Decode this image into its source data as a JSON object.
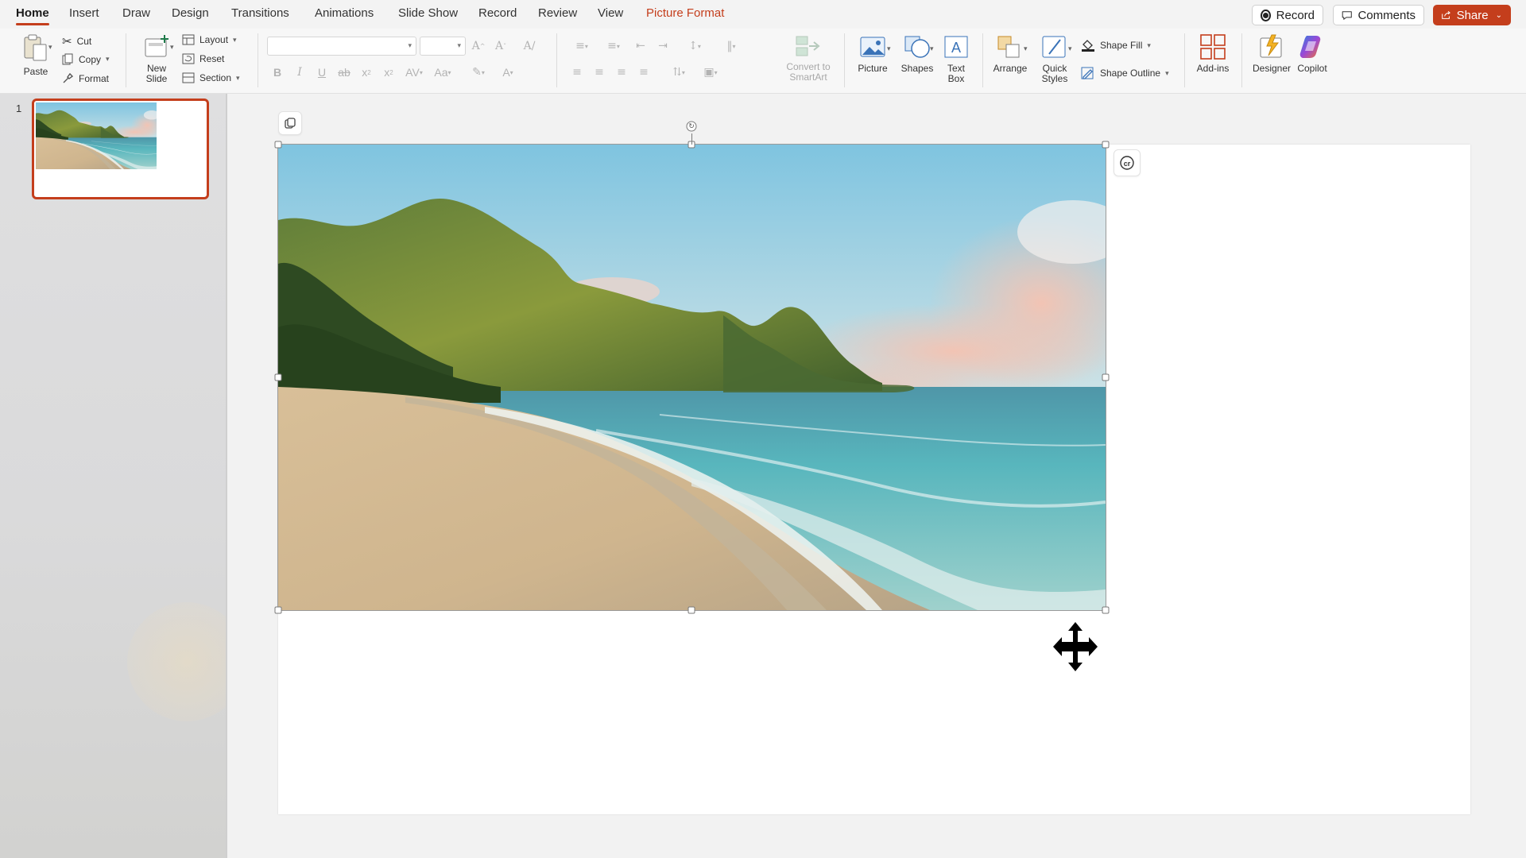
{
  "tabs": [
    {
      "label": "Home",
      "active": true
    },
    {
      "label": "Insert"
    },
    {
      "label": "Draw"
    },
    {
      "label": "Design"
    },
    {
      "label": "Transitions"
    },
    {
      "label": "Animations"
    },
    {
      "label": "Slide Show"
    },
    {
      "label": "Record"
    },
    {
      "label": "Review"
    },
    {
      "label": "View"
    },
    {
      "label": "Picture Format",
      "contextual": true
    }
  ],
  "top_actions": {
    "record_label": "Record",
    "comments_label": "Comments",
    "share_label": "Share"
  },
  "ribbon": {
    "clipboard": {
      "paste": "Paste",
      "cut": "Cut",
      "copy": "Copy",
      "format": "Format"
    },
    "slides": {
      "new_slide_line1": "New",
      "new_slide_line2": "Slide",
      "layout": "Layout",
      "reset": "Reset",
      "section": "Section"
    },
    "font": {
      "font_name": "",
      "font_size": ""
    },
    "paragraph": {
      "convert_line1": "Convert to",
      "convert_line2": "SmartArt"
    },
    "insert": {
      "picture": "Picture",
      "shapes": "Shapes",
      "textbox_line1": "Text",
      "textbox_line2": "Box"
    },
    "drawing": {
      "arrange": "Arrange",
      "quick_styles_line1": "Quick",
      "quick_styles_line2": "Styles",
      "shape_fill": "Shape Fill",
      "shape_outline": "Shape Outline"
    },
    "addins": {
      "addins": "Add-ins",
      "designer": "Designer",
      "copilot": "Copilot"
    }
  },
  "thumbnails": [
    {
      "number": "1",
      "selected": true
    }
  ],
  "colors": {
    "accent": "#c43e1c",
    "canvas": "#f2f2f2",
    "slide": "#ffffff"
  },
  "icons": {
    "cursor": "move-cursor",
    "selection_badge": "picture-selection-icon",
    "corner_badge": "alt-text-icon"
  }
}
